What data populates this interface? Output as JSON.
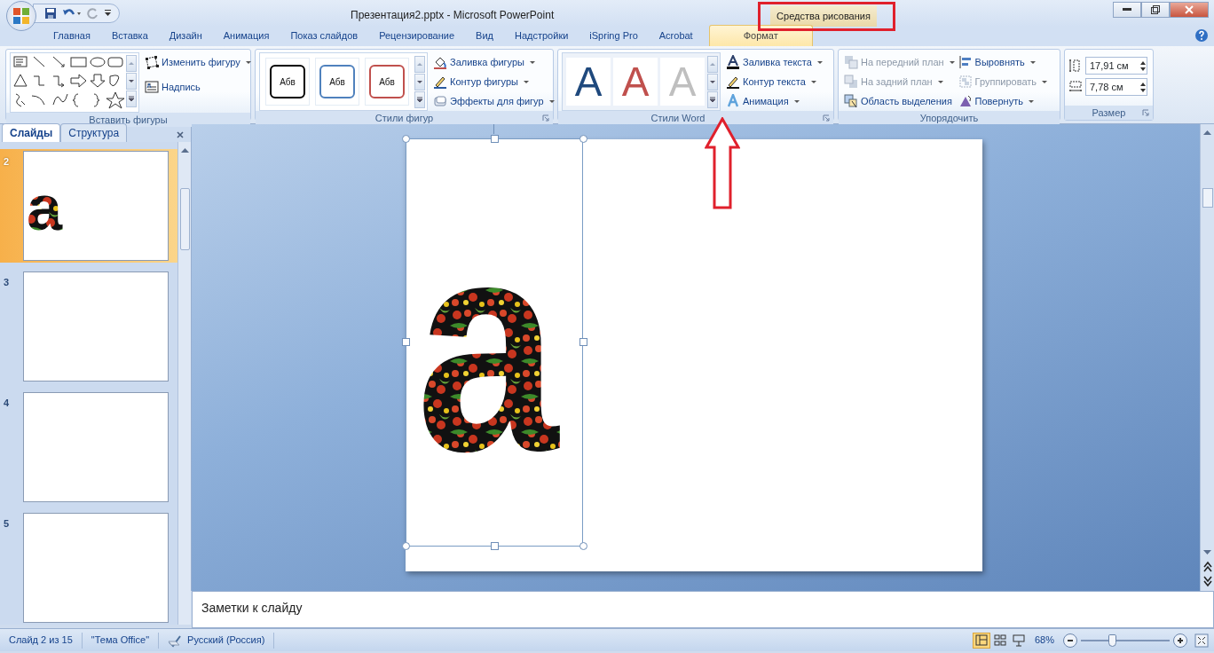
{
  "window": {
    "title": "Презентация2.pptx - Microsoft PowerPoint",
    "context_header": "Средства рисования"
  },
  "ribbon_tabs": [
    {
      "label": "Главная",
      "selected": false
    },
    {
      "label": "Вставка",
      "selected": false
    },
    {
      "label": "Дизайн",
      "selected": false
    },
    {
      "label": "Анимация",
      "selected": false
    },
    {
      "label": "Показ слайдов",
      "selected": false
    },
    {
      "label": "Рецензирование",
      "selected": false
    },
    {
      "label": "Вид",
      "selected": false
    },
    {
      "label": "Надстройки",
      "selected": false
    },
    {
      "label": "iSpring Pro",
      "selected": false
    },
    {
      "label": "Acrobat",
      "selected": false
    },
    {
      "label": "Формат",
      "selected": true
    }
  ],
  "groups": {
    "insert_shapes": {
      "title": "Вставить фигуры",
      "commands": [
        {
          "label": "Изменить фигуру",
          "dropdown": true
        },
        {
          "label": "Надпись",
          "dropdown": false
        }
      ]
    },
    "shape_styles": {
      "title": "Стили фигур",
      "samples": [
        {
          "label": "Абв",
          "color": "#000000"
        },
        {
          "label": "Абв",
          "color": "#4f81bd"
        },
        {
          "label": "Абв",
          "color": "#c0504d"
        }
      ],
      "commands": [
        {
          "label": "Заливка фигуры",
          "dropdown": true
        },
        {
          "label": "Контур фигуры",
          "dropdown": true
        },
        {
          "label": "Эффекты для фигур",
          "dropdown": true
        }
      ]
    },
    "wordart_styles": {
      "title": "Стили Word",
      "samples": [
        {
          "label": "A",
          "color": "#1f497d"
        },
        {
          "label": "A",
          "color": "#c0504d"
        },
        {
          "label": "A",
          "color": "#bfbfbf"
        }
      ],
      "commands": [
        {
          "label": "Заливка текста",
          "dropdown": true
        },
        {
          "label": "Контур текста",
          "dropdown": true
        },
        {
          "label": "Анимация",
          "dropdown": true
        }
      ]
    },
    "arrange": {
      "title": "Упорядочить",
      "commands": [
        {
          "label": "На передний план",
          "disabled": true,
          "dropdown": true
        },
        {
          "label": "На задний план",
          "disabled": true,
          "dropdown": true
        },
        {
          "label": "Область выделения",
          "disabled": false,
          "dropdown": false
        },
        {
          "label": "Выровнять",
          "disabled": false,
          "dropdown": true
        },
        {
          "label": "Группировать",
          "disabled": true,
          "dropdown": true
        },
        {
          "label": "Повернуть",
          "disabled": false,
          "dropdown": true
        }
      ]
    },
    "size": {
      "title": "Размер",
      "height": "17,91 см",
      "width": "7,78 см"
    }
  },
  "slides_pane": {
    "tabs": [
      {
        "label": "Слайды",
        "selected": true
      },
      {
        "label": "Структура",
        "selected": false
      }
    ],
    "slides": [
      {
        "number": "2",
        "selected": true,
        "shape_text": "a"
      },
      {
        "number": "3",
        "selected": false
      },
      {
        "number": "4",
        "selected": false
      },
      {
        "number": "5",
        "selected": false
      }
    ]
  },
  "slide": {
    "shape_text": "a"
  },
  "notes": {
    "placeholder": "Заметки к слайду"
  },
  "status_bar": {
    "slide_info": "Слайд 2 из 15",
    "theme": "\"Тема Office\"",
    "language": "Русский (Россия)",
    "views": [
      {
        "kind": "normal",
        "selected": true
      },
      {
        "kind": "sorter",
        "selected": false
      },
      {
        "kind": "show",
        "selected": false
      }
    ],
    "zoom": "68%",
    "zoom_slider": {
      "level": 0.35
    }
  }
}
